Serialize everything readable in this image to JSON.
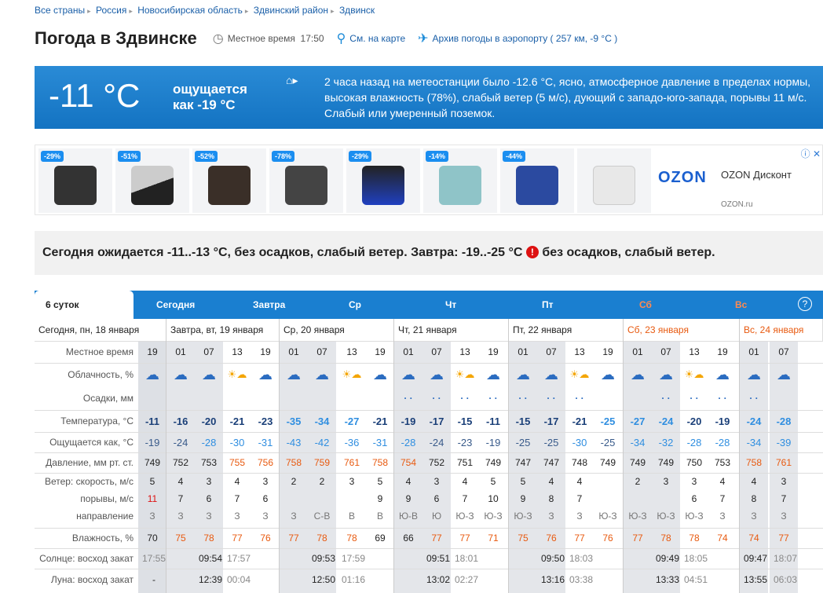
{
  "breadcrumbs": [
    "Все страны",
    "Россия",
    "Новосибирская область",
    "Здвинский район",
    "Здвинск"
  ],
  "page_title": "Погода в Здвинске",
  "local_time_label": "Местное время",
  "local_time": "17:50",
  "map_link": "См. на карте",
  "archive_link": "Архив погоды в аэропорту ( 257 км, -9 °С )",
  "now": {
    "temp": "-11 °C",
    "feels_line1": "ощущается",
    "feels_line2": "как -19 °C",
    "description": "2 часа назад на метеостанции было -12.6 °С, ясно, атмосферное давление в пределах нормы, высокая влажность (78%), слабый ветер (5 м/с), дующий с западо-юго-запада, порывы 11 м/с. Слабый или умеренный поземок."
  },
  "ads": [
    {
      "tag": "-29%"
    },
    {
      "tag": "-51%"
    },
    {
      "tag": "-52%"
    },
    {
      "tag": "-78%"
    },
    {
      "tag": "-29%"
    },
    {
      "tag": "-14%"
    },
    {
      "tag": "-44%"
    },
    {
      "tag": ""
    }
  ],
  "ad_brand": "OZON",
  "ad_name": "OZON Дисконт",
  "ad_site": "OZON.ru",
  "summary_part1": "Сегодня ожидается -11..-13 °С, без осадков, слабый ветер. Завтра: -19..-25 °С",
  "summary_part2": " без осадков, слабый ветер.",
  "warn_icon": "!",
  "tabs": [
    "6 суток",
    "Сегодня",
    "Завтра",
    "Ср",
    "Чт",
    "Пт",
    "Сб",
    "Вс"
  ],
  "help_icon": "?",
  "days": [
    "Сегодня, пн, 18 января",
    "Завтра, вт, 19 января",
    "Ср, 20 января",
    "Чт, 21 января",
    "Пт, 22 января",
    "Сб, 23 января",
    "Вс, 24 января"
  ],
  "row_labels": {
    "time": "Местное время",
    "cloud": "Облачность, %",
    "precip": "Осадки, мм",
    "temp": "Температура, °С",
    "feels": "Ощущается как, °С",
    "pressure": "Давление, мм рт. ст.",
    "wind": "Ветер: скорость, м/с",
    "gusts": "порывы, м/с",
    "dir": "направление",
    "humidity": "Влажность, %",
    "sun": "Солнце: восход закат",
    "moon": "Луна: восход закат"
  },
  "colors": {
    "cold": "#1a6bd0",
    "cold2": "#2f8ee0",
    "warm_pressure": "#e85a10",
    "gust_red": "#d11"
  },
  "hours": [
    "19",
    "01",
    "07",
    "13",
    "19",
    "01",
    "07",
    "13",
    "19",
    "01",
    "07",
    "13",
    "19",
    "01",
    "07",
    "13",
    "19",
    "01",
    "07",
    "13",
    "19",
    "01",
    "07"
  ],
  "temps": [
    "-11",
    "-16",
    "-20",
    "-21",
    "-23",
    "-35",
    "-34",
    "-27",
    "-21",
    "-19",
    "-17",
    "-15",
    "-11",
    "-15",
    "-17",
    "-21",
    "-25",
    "-27",
    "-24",
    "-20",
    "-19",
    "-24",
    "-28"
  ],
  "feels": [
    "-19",
    "-24",
    "-28",
    "-30",
    "-31",
    "-43",
    "-42",
    "-36",
    "-31",
    "-28",
    "-24",
    "-23",
    "-19",
    "-25",
    "-25",
    "-30",
    "-25",
    "-34",
    "-32",
    "-28",
    "-28",
    "-34",
    "-39"
  ],
  "pressure": [
    "749",
    "752",
    "753",
    "755",
    "756",
    "758",
    "759",
    "761",
    "758",
    "754",
    "752",
    "751",
    "749",
    "747",
    "747",
    "748",
    "749",
    "749",
    "749",
    "750",
    "753",
    "758",
    "761"
  ],
  "wind": [
    "5",
    "4",
    "3",
    "4",
    "3",
    "2",
    "2",
    "3",
    "5",
    "4",
    "3",
    "4",
    "5",
    "5",
    "4",
    "4",
    "",
    "2",
    "3",
    "3",
    "4",
    "4",
    "3"
  ],
  "gusts": [
    "11",
    "7",
    "6",
    "7",
    "6",
    "",
    "",
    "",
    "9",
    "9",
    "6",
    "7",
    "10",
    "9",
    "8",
    "7",
    "",
    "",
    "",
    "6",
    "7",
    "8",
    "7"
  ],
  "dirs": [
    "З",
    "З",
    "З",
    "З",
    "З",
    "З",
    "С-В",
    "В",
    "В",
    "Ю-В",
    "Ю",
    "Ю-З",
    "Ю-З",
    "Ю-З",
    "З",
    "З",
    "Ю-З",
    "Ю-З",
    "Ю-З",
    "Ю-З",
    "З",
    "З",
    "З"
  ],
  "humidity": [
    "70",
    "75",
    "78",
    "77",
    "76",
    "77",
    "78",
    "78",
    "69",
    "66",
    "77",
    "77",
    "71",
    "75",
    "76",
    "77",
    "76",
    "77",
    "78",
    "78",
    "74",
    "74",
    "77"
  ],
  "sun": [
    [
      "17:55",
      ""
    ],
    [
      "09:54",
      "17:57"
    ],
    [
      "09:53",
      "17:59"
    ],
    [
      "09:51",
      "18:01"
    ],
    [
      "09:50",
      "18:03"
    ],
    [
      "09:49",
      "18:05"
    ],
    [
      "09:47",
      "18:07"
    ]
  ],
  "moon": [
    [
      "-",
      ""
    ],
    [
      "12:39",
      "00:04"
    ],
    [
      "12:50",
      "01:16"
    ],
    [
      "13:02",
      "02:27"
    ],
    [
      "13:16",
      "03:38"
    ],
    [
      "13:33",
      "04:51"
    ],
    [
      "13:55",
      "06:03"
    ]
  ]
}
